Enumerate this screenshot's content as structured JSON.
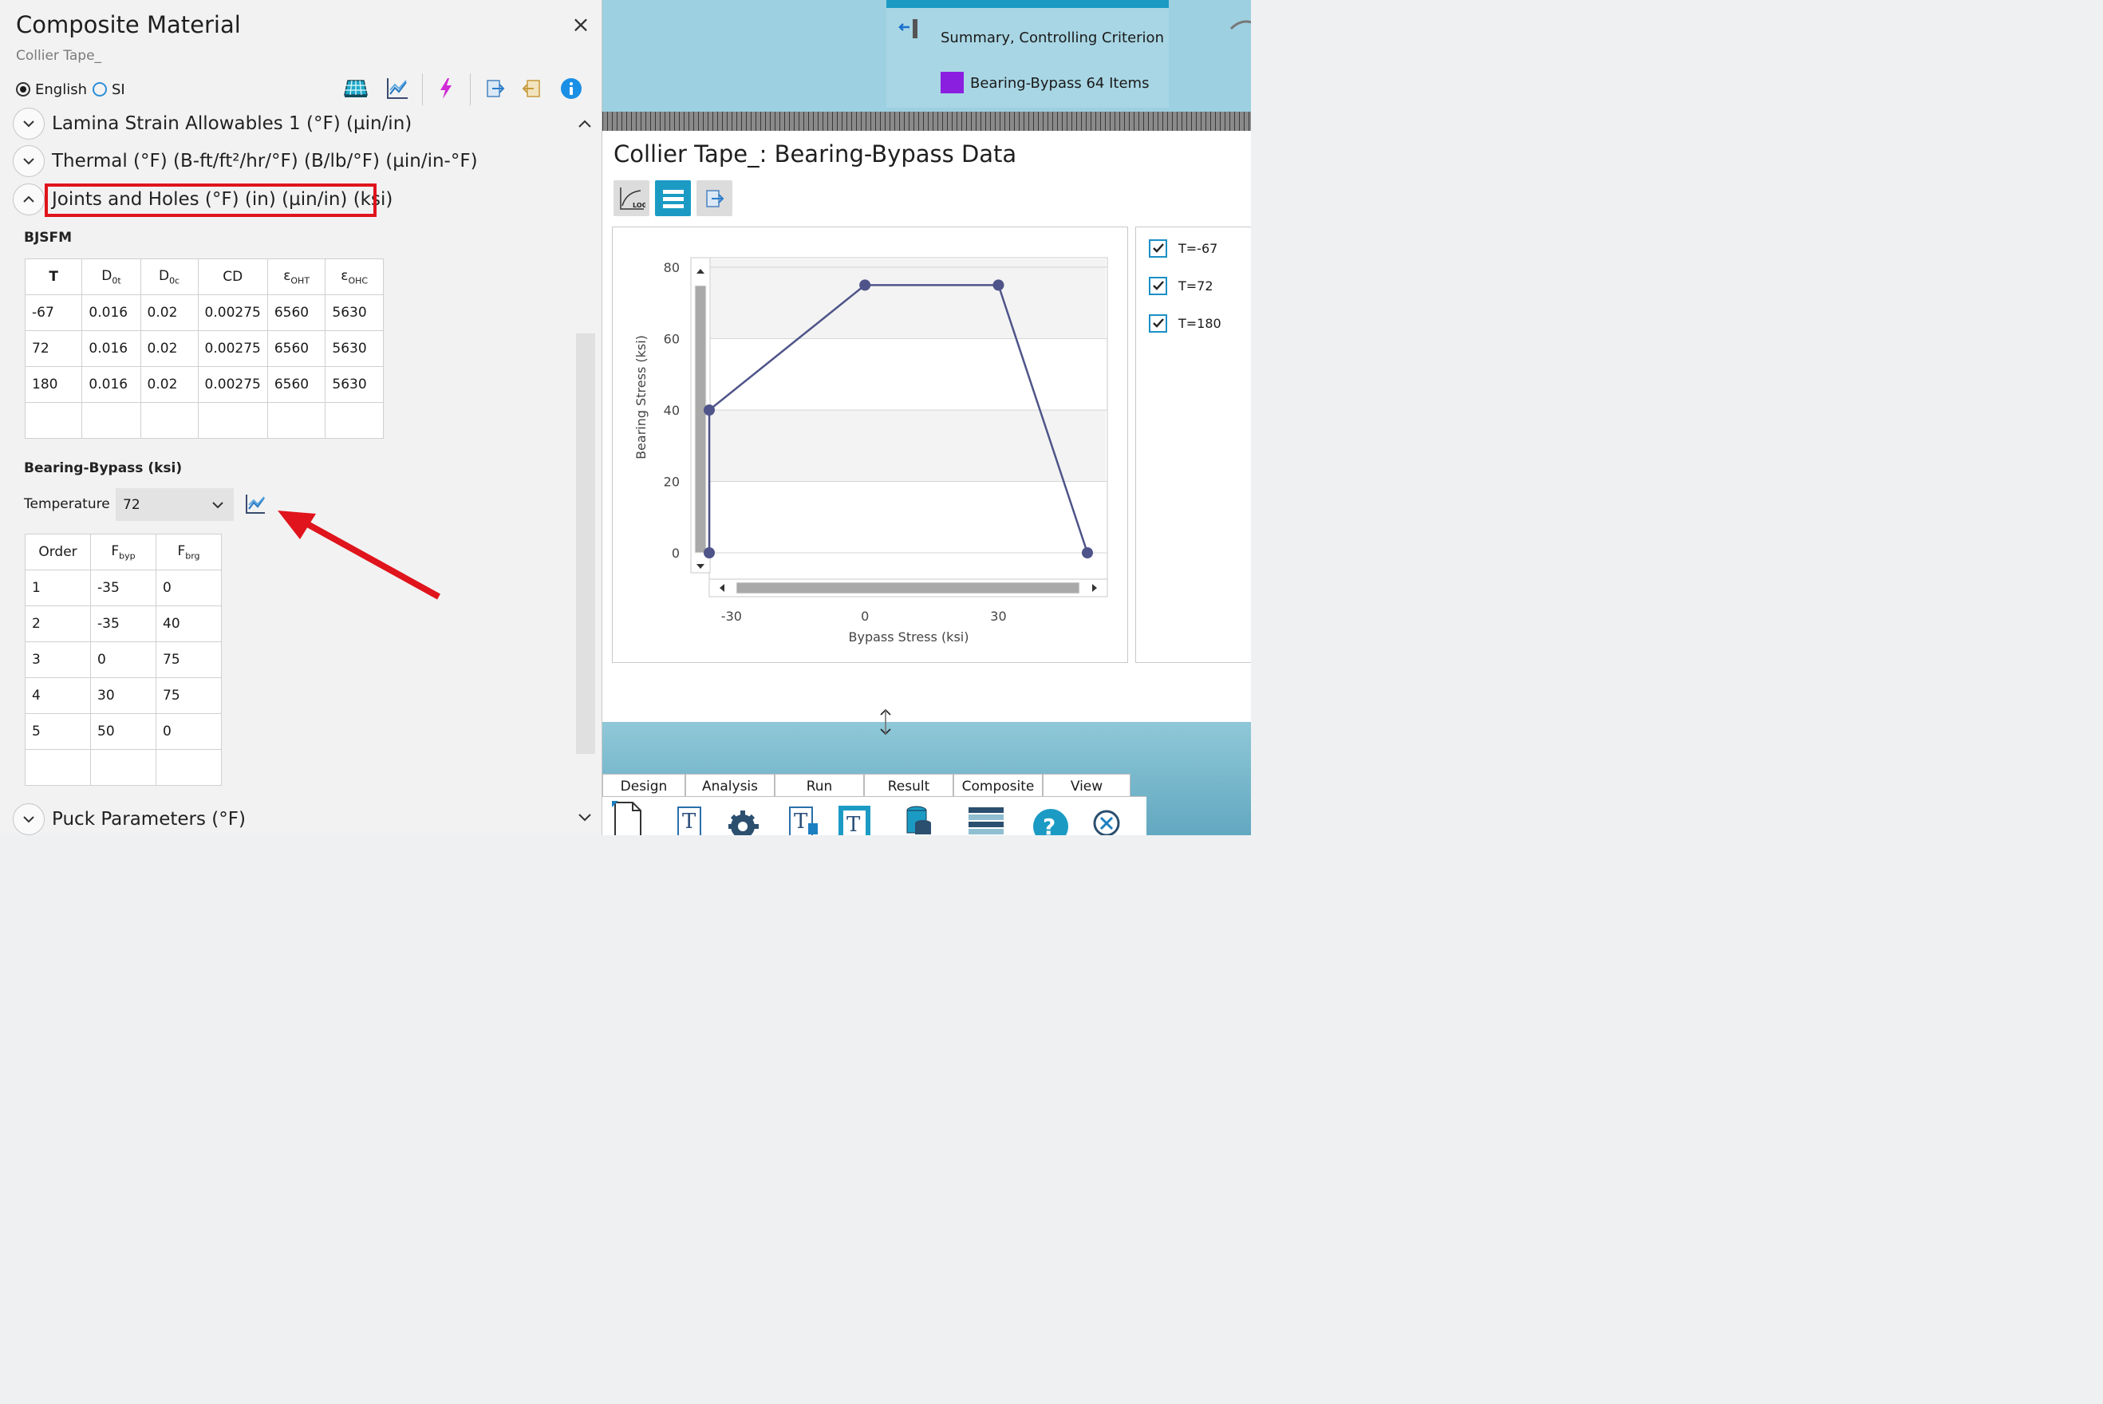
{
  "panel": {
    "title": "Composite Material",
    "subtitle": "Collier Tape_",
    "close_symbol": "×",
    "units": {
      "english": "English",
      "si": "SI",
      "selected": "English"
    },
    "toolbar_icons": [
      "layup-grid-icon",
      "chart-icon",
      "lightning-icon",
      "export-icon",
      "import-icon",
      "info-icon"
    ]
  },
  "sections": {
    "lamina": "Lamina Strain Allowables 1 (°F) (µin/in)",
    "thermal": "Thermal (°F) (B-ft/ft²/hr/°F) (B/lb/°F) (µin/in-°F)",
    "joints": "Joints and Holes (°F) (in) (µin/in) (ksi)",
    "puck": "Puck Parameters (°F)"
  },
  "bjsfm": {
    "heading": "BJSFM",
    "columns": [
      {
        "main": "T",
        "sub": ""
      },
      {
        "main": "D",
        "sub": "0t"
      },
      {
        "main": "D",
        "sub": "0c"
      },
      {
        "main": "CD",
        "sub": ""
      },
      {
        "main": "ε",
        "sub": "OHT"
      },
      {
        "main": "ε",
        "sub": "OHC"
      }
    ],
    "rows": [
      [
        "-67",
        "0.016",
        "0.02",
        "0.00275",
        "6560",
        "5630"
      ],
      [
        "72",
        "0.016",
        "0.02",
        "0.00275",
        "6560",
        "5630"
      ],
      [
        "180",
        "0.016",
        "0.02",
        "0.00275",
        "6560",
        "5630"
      ],
      [
        "",
        "",
        "",
        "",
        "",
        ""
      ]
    ]
  },
  "bearing": {
    "heading": "Bearing-Bypass (ksi)",
    "temperature_label": "Temperature",
    "temperature_value": "72",
    "columns": [
      {
        "main": "Order",
        "sub": ""
      },
      {
        "main": "F",
        "sub": "byp"
      },
      {
        "main": "F",
        "sub": "brg"
      }
    ],
    "rows": [
      [
        "1",
        "-35",
        "0"
      ],
      [
        "2",
        "-35",
        "40"
      ],
      [
        "3",
        "0",
        "75"
      ],
      [
        "4",
        "30",
        "75"
      ],
      [
        "5",
        "50",
        "0"
      ],
      [
        "",
        "",
        ""
      ]
    ]
  },
  "legend": {
    "summary": "Summary, Controlling Criterion",
    "item": "Bearing-Bypass 64 Items",
    "item_color": "#8b1fe0"
  },
  "chart_window": {
    "title": "Collier Tape_: Bearing-Bypass Data",
    "log_button": "LOG",
    "series_checks": [
      {
        "label": "T=-67",
        "checked": true
      },
      {
        "label": "T=72",
        "checked": true
      },
      {
        "label": "T=180",
        "checked": true
      }
    ]
  },
  "chart_data": {
    "type": "line",
    "xlabel": "Bypass Stress (ksi)",
    "ylabel": "Bearing Stress (ksi)",
    "xlim": [
      -35,
      50
    ],
    "ylim": [
      0,
      80
    ],
    "x_ticks": [
      -30,
      0,
      30
    ],
    "y_ticks": [
      0,
      20,
      40,
      60,
      80
    ],
    "grid": true,
    "series": [
      {
        "x": [
          -35,
          -35,
          0,
          30,
          50
        ],
        "y": [
          0,
          40,
          75,
          75,
          0
        ],
        "color": "#4e5489"
      }
    ]
  },
  "ribbon": {
    "tabs": [
      "Design",
      "Analysis",
      "Run",
      "Result",
      "Composite",
      "View"
    ]
  }
}
